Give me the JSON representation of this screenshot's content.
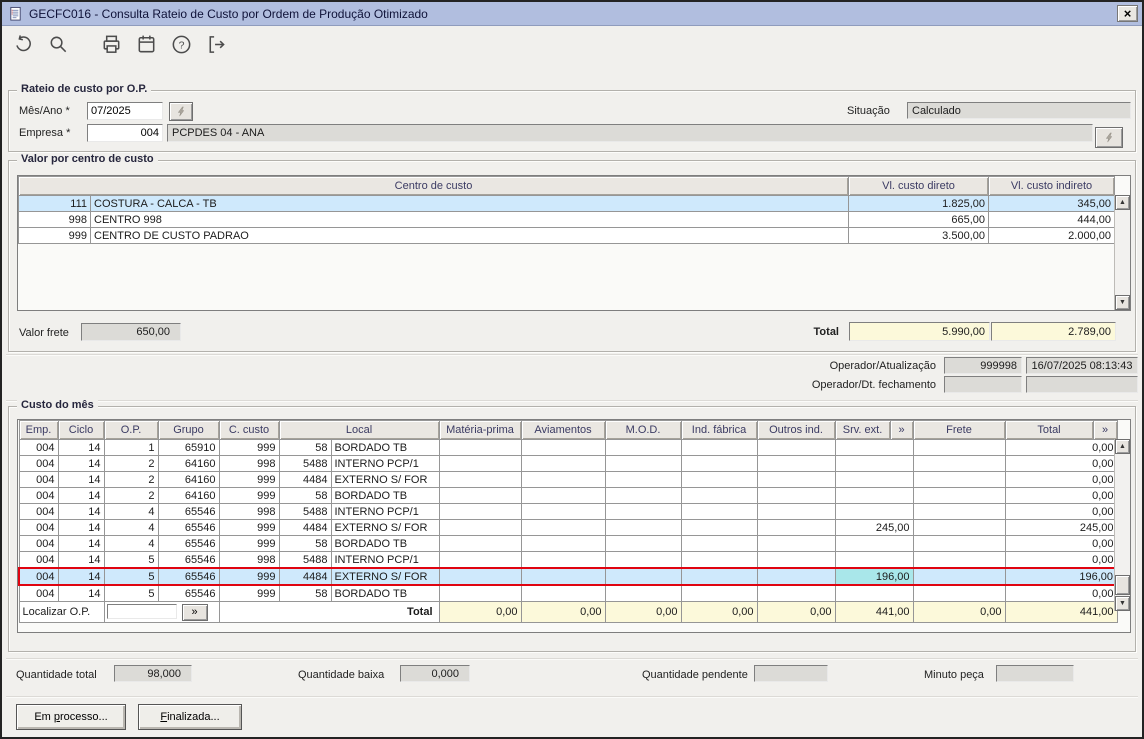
{
  "window": {
    "title": "GECFC016 - Consulta Rateio de Custo por Ordem de Produção Otimizado",
    "close_glyph": "×"
  },
  "toolbar": {
    "icons": [
      "undo",
      "search",
      "print",
      "calendar",
      "help",
      "exit"
    ]
  },
  "rateio": {
    "legend": "Rateio de custo por O.P.",
    "mes_ano_label": "Mês/Ano *",
    "mes_ano_value": "07/2025",
    "empresa_label": "Empresa *",
    "empresa_code": "004",
    "empresa_name": "PCPDES 04 - ANA",
    "situacao_label": "Situação",
    "situacao_value": "Calculado"
  },
  "centro": {
    "legend": "Valor por centro de custo",
    "headers": {
      "centro": "Centro de custo",
      "direto": "Vl. custo direto",
      "indireto": "Vl. custo indireto"
    },
    "rows": [
      {
        "code": "111",
        "name": "COSTURA - CALCA - TB",
        "direto": "1.825,00",
        "indireto": "345,00",
        "selected": true
      },
      {
        "code": "998",
        "name": "CENTRO 998",
        "direto": "665,00",
        "indireto": "444,00",
        "selected": false
      },
      {
        "code": "999",
        "name": "CENTRO DE CUSTO PADRAO",
        "direto": "3.500,00",
        "indireto": "2.000,00",
        "selected": false
      }
    ],
    "valor_frete_label": "Valor frete",
    "valor_frete": "650,00",
    "total_label": "Total",
    "total_direto": "5.990,00",
    "total_indireto": "2.789,00"
  },
  "operador": {
    "atualizacao_label": "Operador/Atualização",
    "atualizacao_user": "999998",
    "atualizacao_date": "16/07/2025 08:13:43",
    "fechamento_label": "Operador/Dt. fechamento",
    "fechamento_user": "",
    "fechamento_date": ""
  },
  "custo": {
    "legend": "Custo do mês",
    "headers": [
      "Emp.",
      "Ciclo",
      "O.P.",
      "Grupo",
      "C. custo",
      "Local",
      "Matéria-prima",
      "Aviamentos",
      "M.O.D.",
      "Ind. fábrica",
      "Outros ind.",
      "Srv. ext.",
      "»",
      "Frete",
      "Total",
      "»"
    ],
    "rows": [
      {
        "emp": "004",
        "ciclo": "14",
        "op": "1",
        "grupo": "65910",
        "ccusto": "999",
        "local_num": "58",
        "local": "BORDADO TB",
        "materia": "",
        "aviamentos": "",
        "mod": "",
        "ind_fabrica": "",
        "outros": "",
        "srv_ext": "",
        "frete": "",
        "total": "0,00",
        "selected": false
      },
      {
        "emp": "004",
        "ciclo": "14",
        "op": "2",
        "grupo": "64160",
        "ccusto": "998",
        "local_num": "5488",
        "local": "INTERNO PCP/1",
        "materia": "",
        "aviamentos": "",
        "mod": "",
        "ind_fabrica": "",
        "outros": "",
        "srv_ext": "",
        "frete": "",
        "total": "0,00",
        "selected": false
      },
      {
        "emp": "004",
        "ciclo": "14",
        "op": "2",
        "grupo": "64160",
        "ccusto": "999",
        "local_num": "4484",
        "local": "EXTERNO S/ FOR",
        "materia": "",
        "aviamentos": "",
        "mod": "",
        "ind_fabrica": "",
        "outros": "",
        "srv_ext": "",
        "frete": "",
        "total": "0,00",
        "selected": false
      },
      {
        "emp": "004",
        "ciclo": "14",
        "op": "2",
        "grupo": "64160",
        "ccusto": "999",
        "local_num": "58",
        "local": "BORDADO TB",
        "materia": "",
        "aviamentos": "",
        "mod": "",
        "ind_fabrica": "",
        "outros": "",
        "srv_ext": "",
        "frete": "",
        "total": "0,00",
        "selected": false
      },
      {
        "emp": "004",
        "ciclo": "14",
        "op": "4",
        "grupo": "65546",
        "ccusto": "998",
        "local_num": "5488",
        "local": "INTERNO PCP/1",
        "materia": "",
        "aviamentos": "",
        "mod": "",
        "ind_fabrica": "",
        "outros": "",
        "srv_ext": "",
        "frete": "",
        "total": "0,00",
        "selected": false
      },
      {
        "emp": "004",
        "ciclo": "14",
        "op": "4",
        "grupo": "65546",
        "ccusto": "999",
        "local_num": "4484",
        "local": "EXTERNO S/ FOR",
        "materia": "",
        "aviamentos": "",
        "mod": "",
        "ind_fabrica": "",
        "outros": "",
        "srv_ext": "245,00",
        "frete": "",
        "total": "245,00",
        "selected": false
      },
      {
        "emp": "004",
        "ciclo": "14",
        "op": "4",
        "grupo": "65546",
        "ccusto": "999",
        "local_num": "58",
        "local": "BORDADO TB",
        "materia": "",
        "aviamentos": "",
        "mod": "",
        "ind_fabrica": "",
        "outros": "",
        "srv_ext": "",
        "frete": "",
        "total": "0,00",
        "selected": false
      },
      {
        "emp": "004",
        "ciclo": "14",
        "op": "5",
        "grupo": "65546",
        "ccusto": "998",
        "local_num": "5488",
        "local": "INTERNO PCP/1",
        "materia": "",
        "aviamentos": "",
        "mod": "",
        "ind_fabrica": "",
        "outros": "",
        "srv_ext": "",
        "frete": "",
        "total": "0,00",
        "selected": false
      },
      {
        "emp": "004",
        "ciclo": "14",
        "op": "5",
        "grupo": "65546",
        "ccusto": "999",
        "local_num": "4484",
        "local": "EXTERNO S/ FOR",
        "materia": "",
        "aviamentos": "",
        "mod": "",
        "ind_fabrica": "",
        "outros": "",
        "srv_ext": "196,00",
        "frete": "",
        "total": "196,00",
        "selected": true
      },
      {
        "emp": "004",
        "ciclo": "14",
        "op": "5",
        "grupo": "65546",
        "ccusto": "999",
        "local_num": "58",
        "local": "BORDADO TB",
        "materia": "",
        "aviamentos": "",
        "mod": "",
        "ind_fabrica": "",
        "outros": "",
        "srv_ext": "",
        "frete": "",
        "total": "0,00",
        "selected": false
      }
    ],
    "localizar_label": "Localizar O.P.",
    "localizar_value": "",
    "localizar_button": "»",
    "total_label": "Total",
    "totals": {
      "materia": "0,00",
      "aviamentos": "0,00",
      "mod": "0,00",
      "ind_fabrica": "0,00",
      "outros": "0,00",
      "srv_ext": "441,00",
      "frete": "0,00",
      "total": "441,00"
    }
  },
  "footer": {
    "qt_total_label": "Quantidade total",
    "qt_total": "98,000",
    "qt_baixa_label": "Quantidade baixa",
    "qt_baixa": "0,000",
    "qt_pendente_label": "Quantidade pendente",
    "qt_pendente": "",
    "minuto_label": "Minuto peça",
    "minuto": "",
    "buttons": [
      {
        "label": "Em processo...",
        "accel": "p"
      },
      {
        "label": "Finalizada...",
        "accel": "F"
      }
    ]
  },
  "colors": {
    "titlebar": "#b1bedf",
    "titlebar_text": "#0f1238",
    "window_bg": "#f1f0ed",
    "selection": "#cfe9fc",
    "selection_border": "#e00410",
    "cell_highlight": "#a9e7ea",
    "totals_bg": "#fcf9da",
    "readonly_bg": "#dcdbd7",
    "grid_line": "#969696",
    "header_text": "#3b3b63"
  }
}
